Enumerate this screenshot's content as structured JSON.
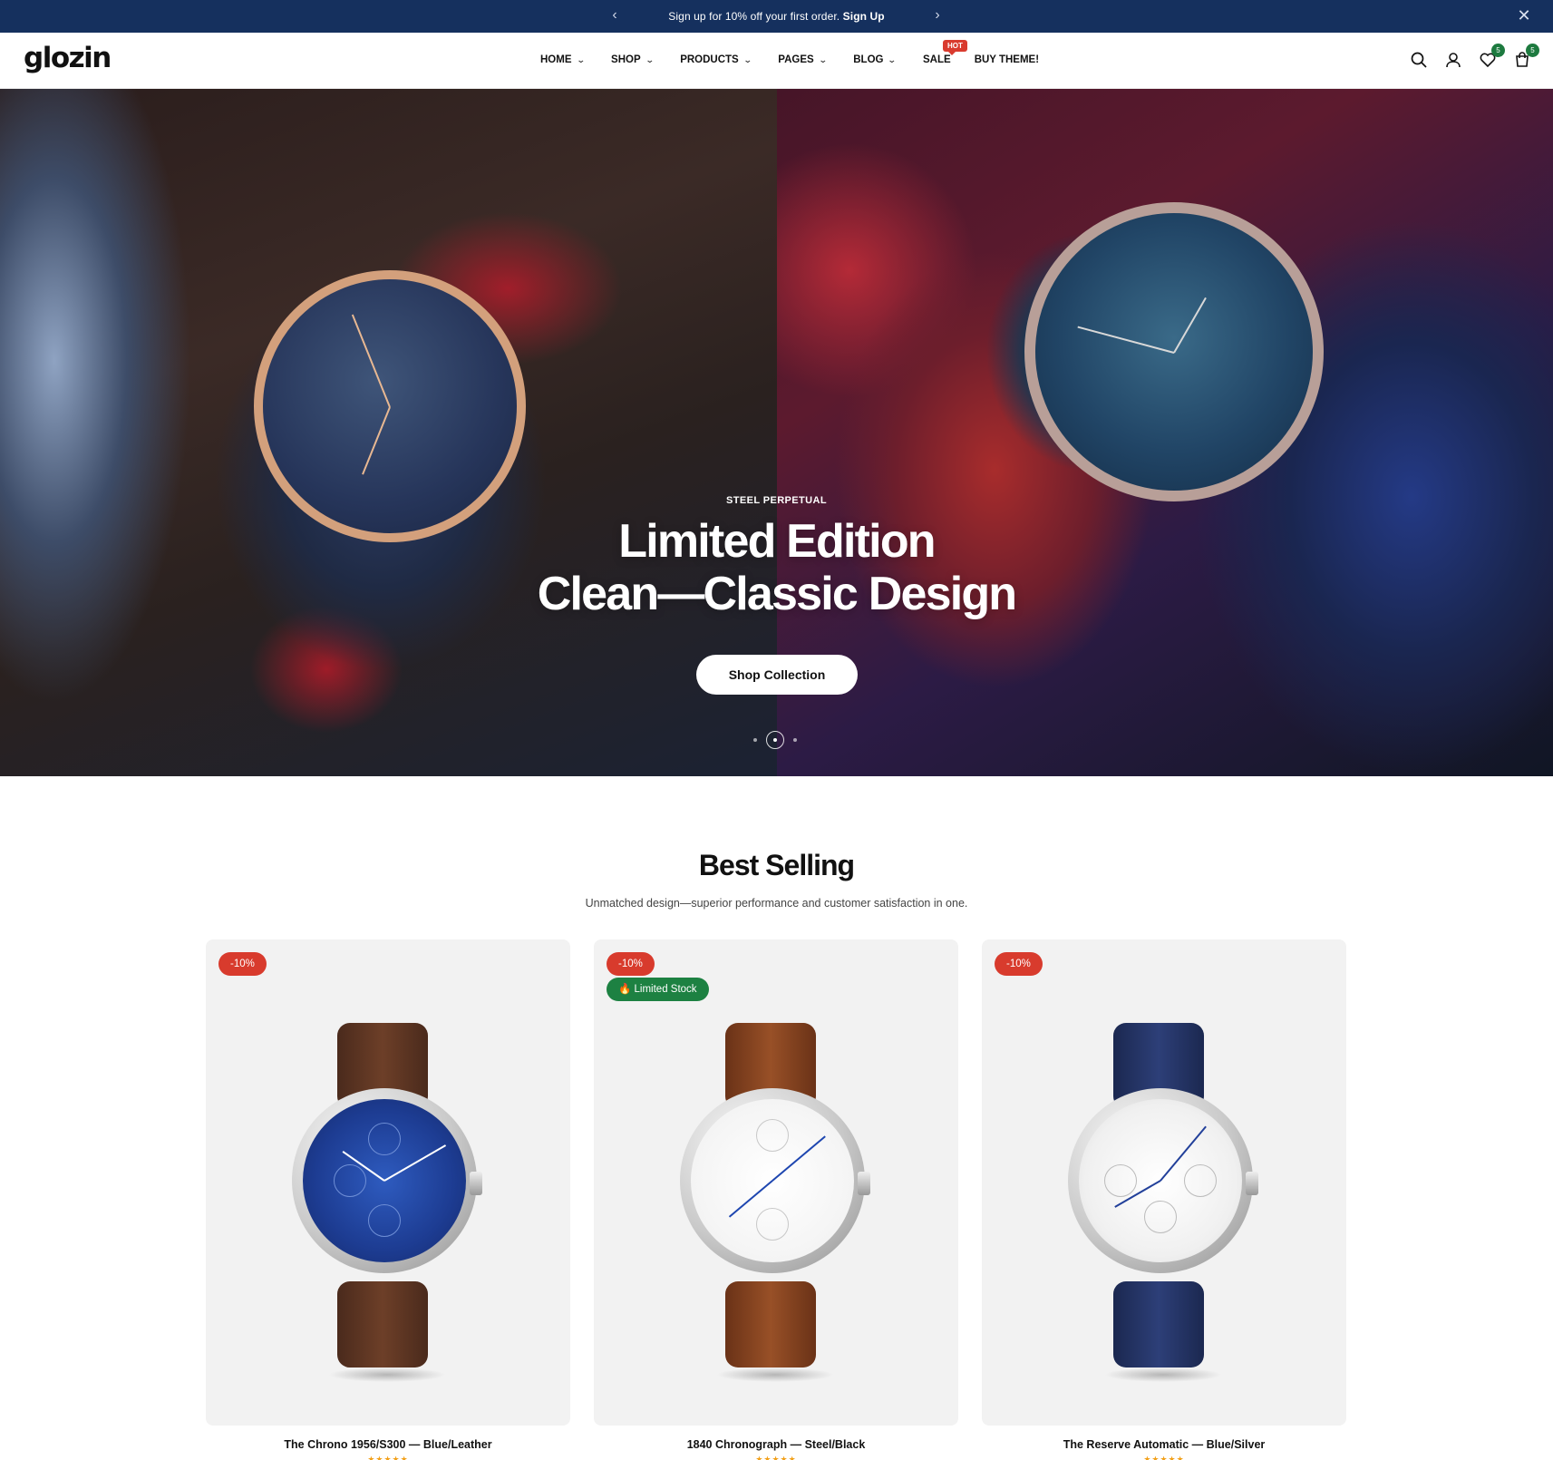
{
  "announcement": {
    "text": "Sign up for 10% off your first order.",
    "link": "Sign Up",
    "prev_icon": "chevron-left-icon",
    "next_icon": "chevron-right-icon",
    "close_icon": "close-icon"
  },
  "header": {
    "logo": "glozin",
    "nav": [
      {
        "label": "HOME",
        "has_dropdown": true
      },
      {
        "label": "SHOP",
        "has_dropdown": true
      },
      {
        "label": "PRODUCTS",
        "has_dropdown": true
      },
      {
        "label": "PAGES",
        "has_dropdown": true
      },
      {
        "label": "BLOG",
        "has_dropdown": true
      },
      {
        "label": "SALE",
        "badge": "HOT"
      },
      {
        "label": "BUY THEME!"
      }
    ],
    "wishlist_count": "5",
    "cart_count": "5",
    "icons": [
      "search-icon",
      "account-icon",
      "heart-icon",
      "cart-icon"
    ]
  },
  "hero": {
    "eyebrow": "STEEL PERPETUAL",
    "title_line1": "Limited Edition",
    "title_line2": "Clean—Classic Design",
    "cta": "Shop Collection",
    "slides": 3,
    "active_slide": 2
  },
  "best_selling": {
    "title": "Best Selling",
    "subtitle": "Unmatched design—superior performance and customer satisfaction in one.",
    "products": [
      {
        "name": "The Chrono 1956/S300 — Blue/Leather",
        "discount": "-10%",
        "stock_badge": "",
        "rating": 5
      },
      {
        "name": "1840 Chronograph — Steel/Black",
        "discount": "-10%",
        "stock_badge": "🔥 Limited Stock",
        "rating": 5
      },
      {
        "name": "The Reserve Automatic — Blue/Silver",
        "discount": "-10%",
        "stock_badge": "",
        "rating": 5
      }
    ]
  },
  "colors": {
    "announce_bg": "#15305e",
    "sale_badge": "#d83b2d",
    "stock_badge": "#1d8142",
    "count_badge": "#1d7a3f",
    "rating": "#f2a11b"
  }
}
